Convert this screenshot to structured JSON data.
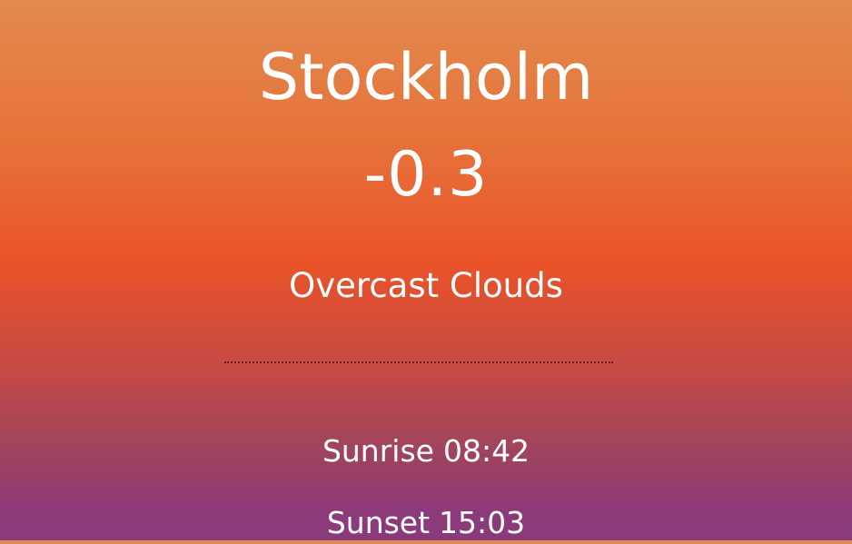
{
  "location": {
    "city": "Stockholm"
  },
  "current": {
    "temperature": "-0.3",
    "description": "Overcast Clouds"
  },
  "sun": {
    "sunrise_label": "Sunrise",
    "sunrise_time": "08:42",
    "sunset_label": "Sunset",
    "sunset_time": "15:03"
  },
  "colors": {
    "top": "#e28a4f",
    "middle": "#ea5329",
    "bottom": "#8a3a7c",
    "text": "#ffffff"
  }
}
